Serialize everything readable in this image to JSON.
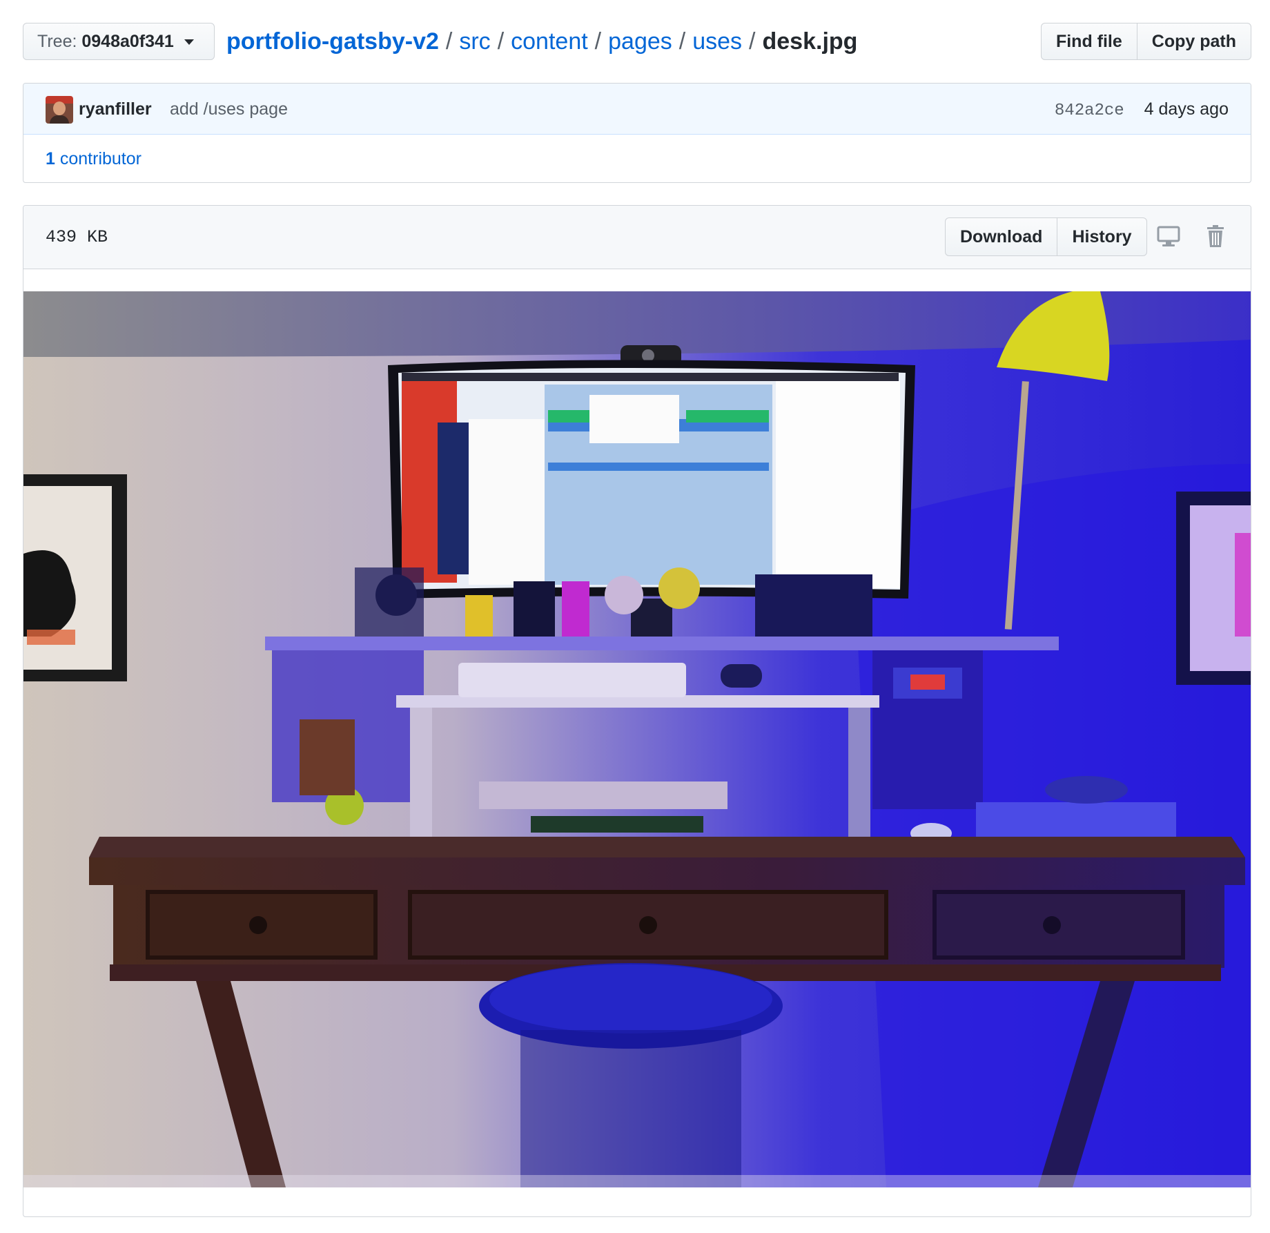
{
  "tree": {
    "prefix": "Tree:",
    "sha": "0948a0f341"
  },
  "breadcrumb": {
    "repo": "portfolio-gatsby-v2",
    "separator": "/",
    "path": [
      "src",
      "content",
      "pages",
      "uses"
    ],
    "file": "desk.jpg"
  },
  "header_actions": {
    "find_file": "Find file",
    "copy_path": "Copy path"
  },
  "commit": {
    "author": "ryanfiller",
    "message": "add /uses page",
    "sha": "842a2ce",
    "time": "4 days ago"
  },
  "contributors": {
    "count": "1",
    "label": "contributor"
  },
  "file": {
    "size": "439 KB",
    "download": "Download",
    "history": "History"
  },
  "icons": {
    "caret": "chevron-down-icon",
    "desktop": "desktop-icon",
    "trash": "trash-icon"
  },
  "colors": {
    "link": "#0366d6",
    "text": "#24292e",
    "muted": "#586069",
    "commit_bg": "#f1f8ff",
    "header_bg": "#f6f8fa"
  }
}
